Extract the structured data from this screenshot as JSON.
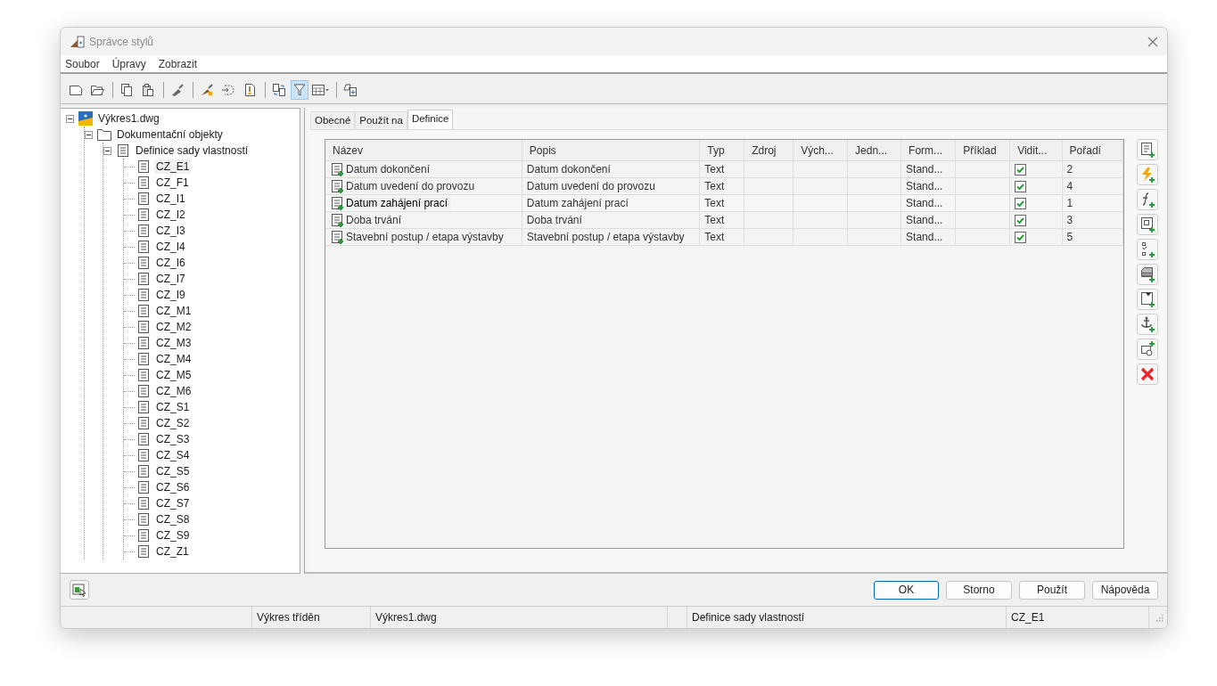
{
  "window": {
    "title": "Správce stylů"
  },
  "menu": [
    "Soubor",
    "Úpravy",
    "Zobrazit"
  ],
  "toolbar": {
    "filter_on": true
  },
  "tree": {
    "label": "Výkres1.dwg",
    "kind": "drawing",
    "expanded": true,
    "children": [
      {
        "label": "Dokumentační objekty",
        "kind": "folder",
        "expanded": true,
        "children": [
          {
            "label": "Definice sady vlastností",
            "kind": "list",
            "expanded": true,
            "children": [
              {
                "label": "CZ_E1",
                "kind": "list",
                "selected": true
              },
              {
                "label": "CZ_F1",
                "kind": "list",
                "selected": false
              },
              {
                "label": "CZ_I1",
                "kind": "list",
                "selected": false
              },
              {
                "label": "CZ_I2",
                "kind": "list",
                "selected": false
              },
              {
                "label": "CZ_I3",
                "kind": "list",
                "selected": false
              },
              {
                "label": "CZ_I4",
                "kind": "list",
                "selected": false
              },
              {
                "label": "CZ_I6",
                "kind": "list",
                "selected": false
              },
              {
                "label": "CZ_I7",
                "kind": "list",
                "selected": false
              },
              {
                "label": "CZ_I9",
                "kind": "list",
                "selected": false
              },
              {
                "label": "CZ_M1",
                "kind": "list",
                "selected": false
              },
              {
                "label": "CZ_M2",
                "kind": "list",
                "selected": false
              },
              {
                "label": "CZ_M3",
                "kind": "list",
                "selected": false
              },
              {
                "label": "CZ_M4",
                "kind": "list",
                "selected": false
              },
              {
                "label": "CZ_M5",
                "kind": "list",
                "selected": false
              },
              {
                "label": "CZ_M6",
                "kind": "list",
                "selected": false
              },
              {
                "label": "CZ_S1",
                "kind": "list",
                "selected": false
              },
              {
                "label": "CZ_S2",
                "kind": "list",
                "selected": false
              },
              {
                "label": "CZ_S3",
                "kind": "list",
                "selected": false
              },
              {
                "label": "CZ_S4",
                "kind": "list",
                "selected": false
              },
              {
                "label": "CZ_S5",
                "kind": "list",
                "selected": false
              },
              {
                "label": "CZ_S6",
                "kind": "list",
                "selected": false
              },
              {
                "label": "CZ_S7",
                "kind": "list",
                "selected": false
              },
              {
                "label": "CZ_S8",
                "kind": "list",
                "selected": false
              },
              {
                "label": "CZ_S9",
                "kind": "list",
                "selected": false
              },
              {
                "label": "CZ_Z1",
                "kind": "list",
                "selected": false
              }
            ]
          }
        ]
      }
    ]
  },
  "tabs": [
    {
      "label": "Obecné",
      "selected": false
    },
    {
      "label": "Použít na",
      "selected": false
    },
    {
      "label": "Definice",
      "selected": true
    }
  ],
  "table": {
    "columns": [
      "Název",
      "Popis",
      "Typ",
      "Zdroj",
      "Vých...",
      "Jedn...",
      "Form...",
      "Příklad",
      "Vidit...",
      "Pořadí"
    ],
    "rows": [
      {
        "name": "Datum dokončení",
        "description": "Datum dokončení",
        "type": "Text",
        "format": "Stand...",
        "visible": true,
        "order": "2",
        "selected": false
      },
      {
        "name": "Datum uvedení do provozu",
        "description": "Datum uvedení do provozu",
        "type": "Text",
        "format": "Stand...",
        "visible": true,
        "order": "4",
        "selected": false
      },
      {
        "name": "Datum zahájení prací",
        "description": "Datum zahájení prací",
        "type": "Text",
        "format": "Stand...",
        "visible": true,
        "order": "1",
        "selected": true
      },
      {
        "name": "Doba trvání",
        "description": "Doba trvání",
        "type": "Text",
        "format": "Stand...",
        "visible": true,
        "order": "3",
        "selected": false
      },
      {
        "name": "Stavební postup / etapa výstavby",
        "description": "Stavební postup / etapa výstavby",
        "type": "Text",
        "format": "Stand...",
        "visible": true,
        "order": "5",
        "selected": false
      }
    ]
  },
  "buttons": [
    {
      "label": "OK",
      "default": true
    },
    {
      "label": "Storno",
      "default": false
    },
    {
      "label": "Použít",
      "default": false
    },
    {
      "label": "Nápověda",
      "default": false
    }
  ],
  "status_bar": [
    "Výkres tříděn",
    "Výkres1.dwg",
    "Definice sady vlastností",
    "CZ_E1"
  ]
}
